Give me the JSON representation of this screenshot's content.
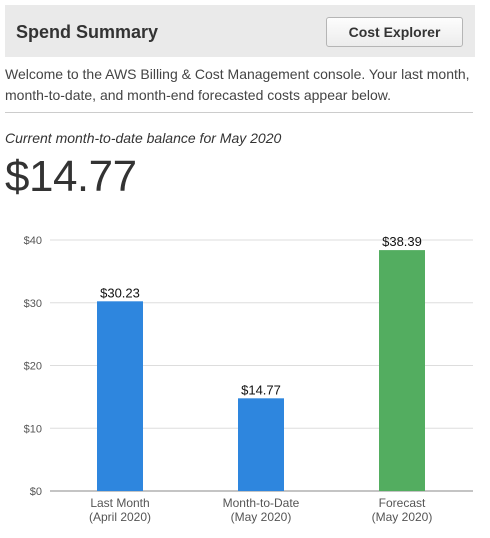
{
  "header": {
    "title": "Spend Summary",
    "button_label": "Cost Explorer"
  },
  "welcome_text": "Welcome to the AWS Billing & Cost Management console. Your last month, month-to-date, and month-end forecasted costs appear below.",
  "balance": {
    "label": "Current month-to-date balance for May 2020",
    "value": "$14.77"
  },
  "chart_data": {
    "type": "bar",
    "categories": [
      [
        "Last Month",
        "(April 2020)"
      ],
      [
        "Month-to-Date",
        "(May 2020)"
      ],
      [
        "Forecast",
        "(May 2020)"
      ]
    ],
    "values": [
      30.23,
      14.77,
      38.39
    ],
    "value_labels": [
      "$30.23",
      "$14.77",
      "$38.39"
    ],
    "colors": [
      "#2e86de",
      "#2e86de",
      "#53ad60"
    ],
    "ylim": [
      0,
      40
    ],
    "yticks": [
      0,
      10,
      20,
      30,
      40
    ],
    "ytick_labels": [
      "$0",
      "$10",
      "$20",
      "$30",
      "$40"
    ],
    "grid": true
  }
}
